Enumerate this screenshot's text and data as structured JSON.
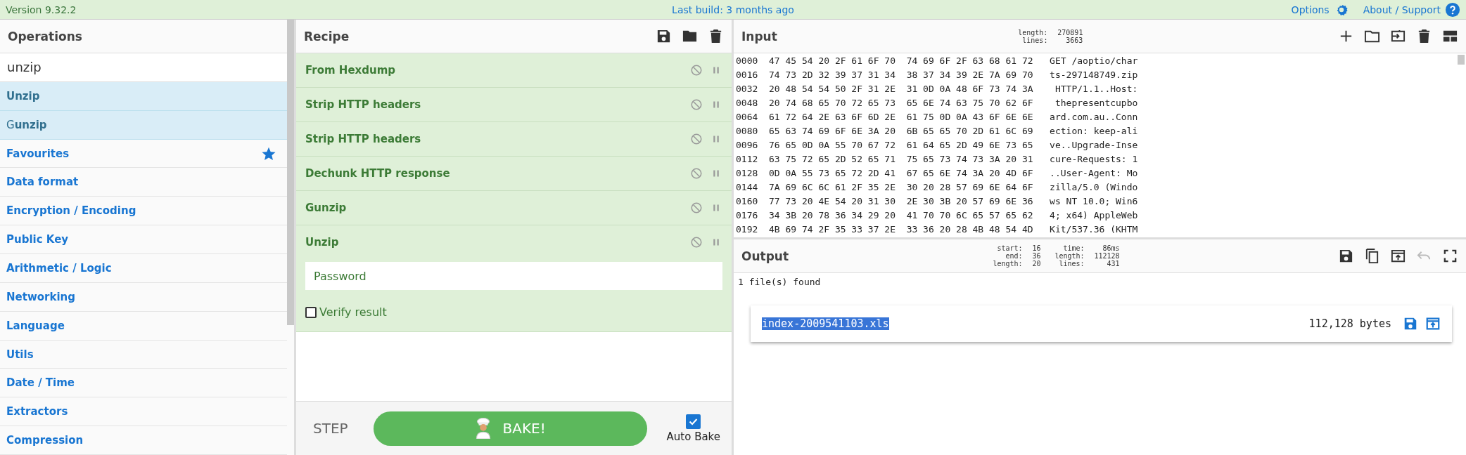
{
  "top_bar": {
    "version": "Version 9.32.2",
    "last_build": "Last build: 3 months ago",
    "options": "Options",
    "about": "About / Support"
  },
  "operations": {
    "title": "Operations",
    "search": {
      "value": "unzip"
    },
    "results": [
      {
        "label": "**Unzip**"
      },
      {
        "label": "G**unzip**"
      }
    ],
    "categories": [
      {
        "label": "Favourites",
        "kind": "favourites"
      },
      {
        "label": "Data format",
        "kind": "plain"
      },
      {
        "label": "Encryption / Encoding",
        "kind": "plain"
      },
      {
        "label": "Public Key",
        "kind": "plain"
      },
      {
        "label": "Arithmetic / Logic",
        "kind": "plain"
      },
      {
        "label": "Networking",
        "kind": "plain"
      },
      {
        "label": "Language",
        "kind": "plain"
      },
      {
        "label": "Utils",
        "kind": "plain"
      },
      {
        "label": "Date / Time",
        "kind": "plain"
      },
      {
        "label": "Extractors",
        "kind": "plain"
      },
      {
        "label": "Compression",
        "kind": "plain"
      }
    ]
  },
  "recipe": {
    "title": "Recipe",
    "ingredients": [
      {
        "name": "From Hexdump"
      },
      {
        "name": "Strip HTTP headers"
      },
      {
        "name": "Strip HTTP headers"
      },
      {
        "name": "Dechunk HTTP response"
      },
      {
        "name": "Gunzip"
      },
      {
        "name": "Unzip",
        "args": {
          "password": {
            "placeholder": "Password"
          },
          "verify": {
            "label": "Verify result",
            "checked": false
          }
        }
      }
    ],
    "step": "STEP",
    "bake": "BAKE!",
    "auto_bake": {
      "label": "Auto Bake",
      "checked": true
    }
  },
  "input": {
    "title": "Input",
    "stats": [
      [
        "length:",
        "270891"
      ],
      [
        "lines:",
        "3663"
      ]
    ],
    "lines": [
      "0000  47 45 54 20 2F 61 6F 70  74 69 6F 2F 63 68 61 72   GET /aoptio/char",
      "0016  74 73 2D 32 39 37 31 34  38 37 34 39 2E 7A 69 70   ts-297148749.zip",
      "0032  20 48 54 54 50 2F 31 2E  31 0D 0A 48 6F 73 74 3A    HTTP/1.1..Host:",
      "0048  20 74 68 65 70 72 65 73  65 6E 74 63 75 70 62 6F    thepresentcupbo",
      "0064  61 72 64 2E 63 6F 6D 2E  61 75 0D 0A 43 6F 6E 6E   ard.com.au..Conn",
      "0080  65 63 74 69 6F 6E 3A 20  6B 65 65 70 2D 61 6C 69   ection: keep-ali",
      "0096  76 65 0D 0A 55 70 67 72  61 64 65 2D 49 6E 73 65   ve..Upgrade-Inse",
      "0112  63 75 72 65 2D 52 65 71  75 65 73 74 73 3A 20 31   cure-Requests: 1",
      "0128  0D 0A 55 73 65 72 2D 41  67 65 6E 74 3A 20 4D 6F   ..User-Agent: Mo",
      "0144  7A 69 6C 6C 61 2F 35 2E  30 20 28 57 69 6E 64 6F   zilla/5.0 (Windo",
      "0160  77 73 20 4E 54 20 31 30  2E 30 3B 20 57 69 6E 36   ws NT 10.0; Win6",
      "0176  34 3B 20 78 36 34 29 20  41 70 70 6C 65 57 65 62   4; x64) AppleWeb",
      "0192  4B 69 74 2F 35 33 37 2E  33 36 20 28 4B 48 54 4D   Kit/537.36 (KHTM"
    ]
  },
  "output": {
    "title": "Output",
    "stats": [
      [
        "start:",
        "16",
        "time:",
        "86ms"
      ],
      [
        "end:",
        "36",
        "length:",
        "112128"
      ],
      [
        "length:",
        "20",
        "lines:",
        "431"
      ]
    ],
    "summary": "1 file(s) found",
    "file": {
      "name": "index-2009541103.xls",
      "size": "112,128 bytes"
    }
  }
}
